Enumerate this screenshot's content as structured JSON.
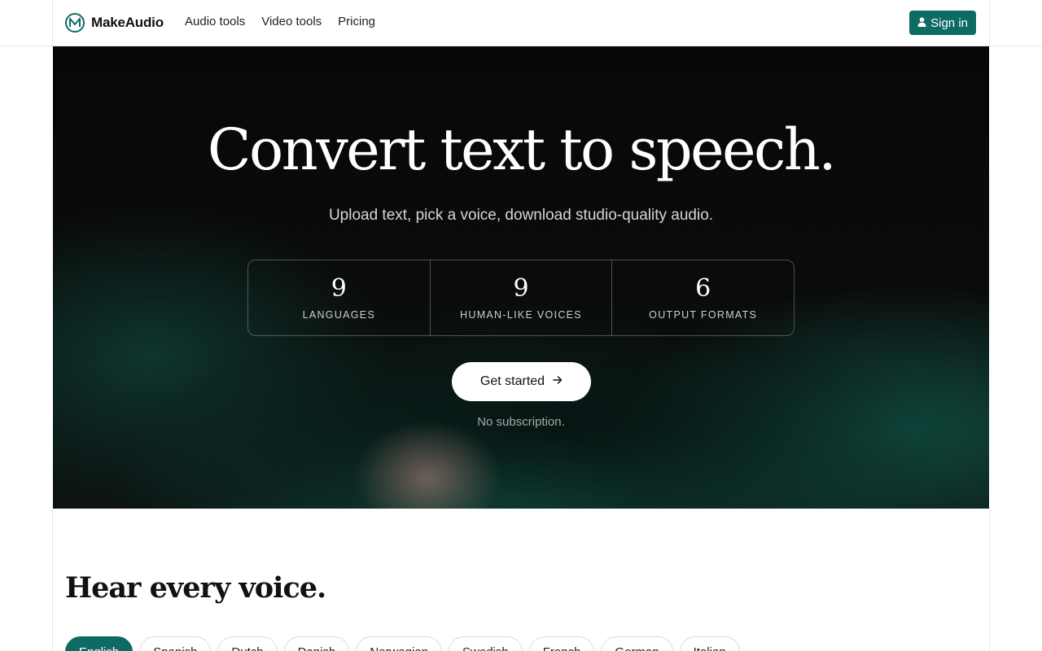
{
  "header": {
    "brand": "MakeAudio",
    "nav": [
      "Audio tools",
      "Video tools",
      "Pricing"
    ],
    "signin_label": "Sign in"
  },
  "hero": {
    "title": "Convert text to speech.",
    "subtitle": "Upload text, pick a voice, download studio-quality audio.",
    "stats": [
      {
        "value": "9",
        "label": "LANGUAGES"
      },
      {
        "value": "9",
        "label": "HUMAN-LIKE VOICES"
      },
      {
        "value": "6",
        "label": "OUTPUT FORMATS"
      }
    ],
    "cta_label": "Get started",
    "cta_note": "No subscription."
  },
  "voices": {
    "title": "Hear every voice.",
    "languages": [
      "English",
      "Spanish",
      "Dutch",
      "Danish",
      "Norwegian",
      "Swedish",
      "French",
      "German",
      "Italian"
    ],
    "selected": "English"
  },
  "colors": {
    "accent": "#0e6b64",
    "hero_bg": "#0a0b0b"
  }
}
